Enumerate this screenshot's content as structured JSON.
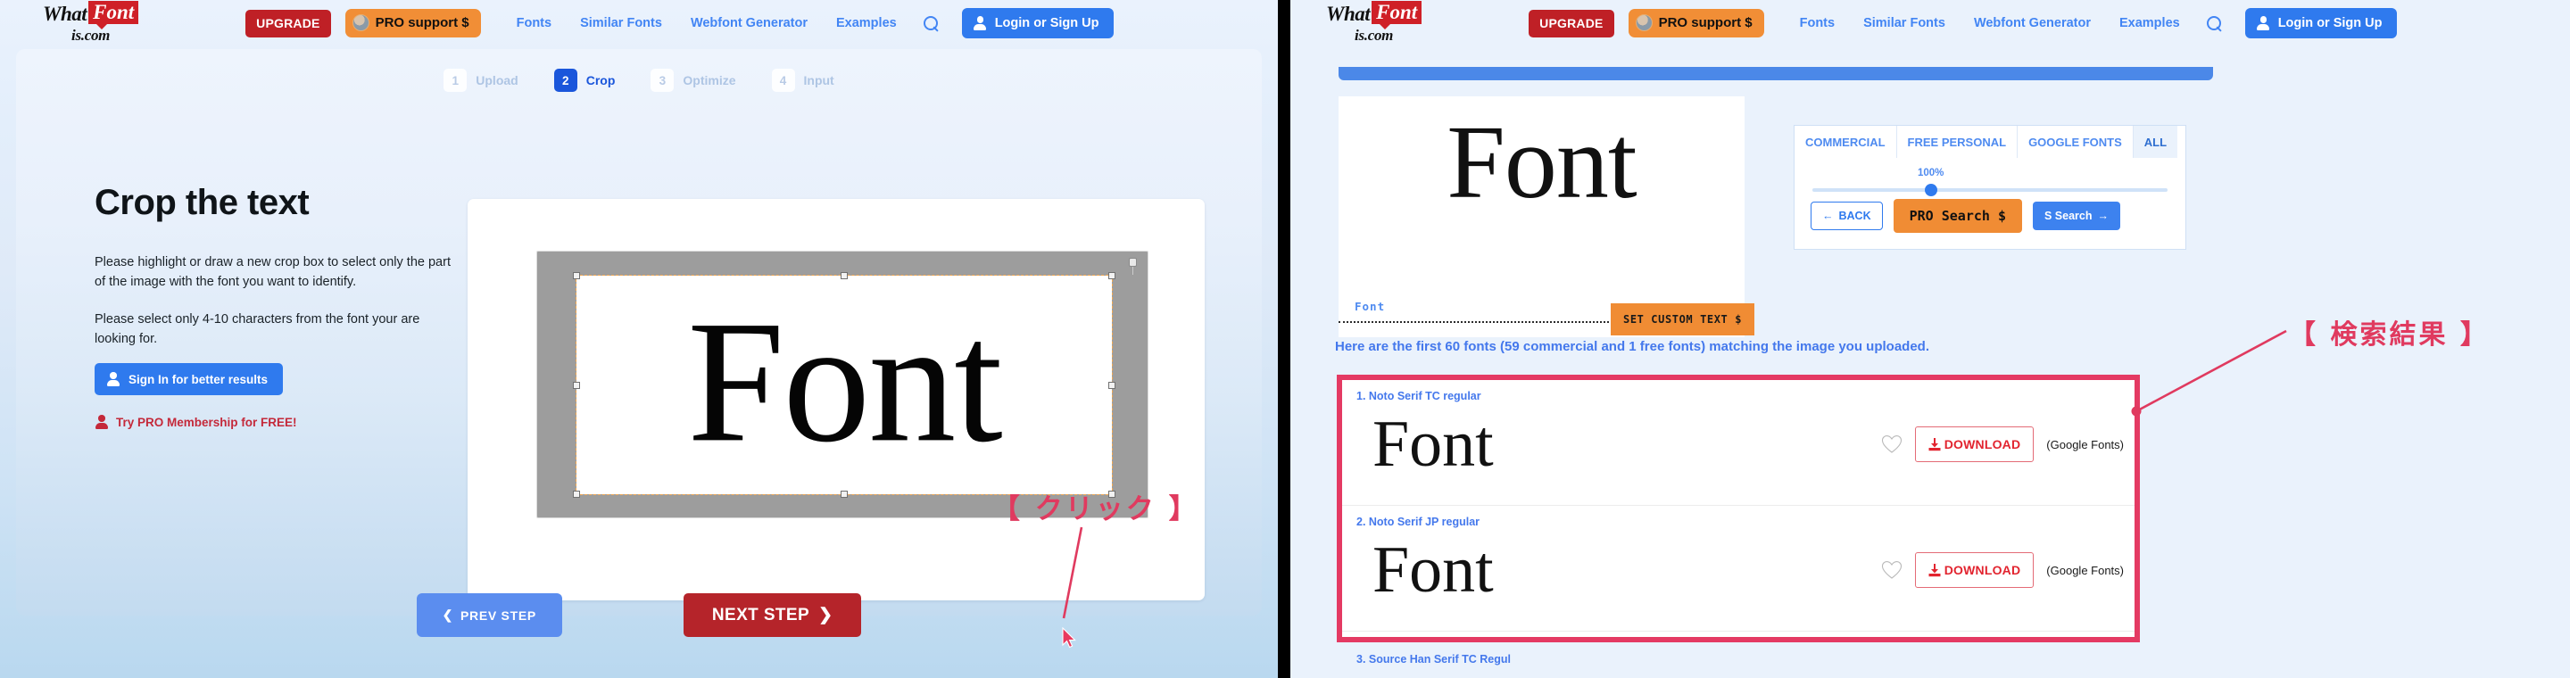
{
  "header": {
    "logo": {
      "word1": "What",
      "word2": "Font",
      "line2": "is.com"
    },
    "upgrade_label": "UPGRADE",
    "pro_support_label": "PRO support $",
    "nav": [
      {
        "label": "Fonts"
      },
      {
        "label": "Similar Fonts"
      },
      {
        "label": "Webfont Generator"
      },
      {
        "label": "Examples"
      }
    ],
    "search_icon": "search-icon",
    "login_label": "Login or Sign Up"
  },
  "left_panel": {
    "steps": [
      {
        "num": "1",
        "label": "Upload",
        "active": false
      },
      {
        "num": "2",
        "label": "Crop",
        "active": true
      },
      {
        "num": "3",
        "label": "Optimize",
        "active": false
      },
      {
        "num": "4",
        "label": "Input",
        "active": false
      }
    ],
    "title": "Crop the text",
    "paragraph1": "Please highlight or draw a new crop box to select only the part of the image with the font you want to identify.",
    "paragraph2": "Please select only 4-10 characters from the font your are looking for.",
    "signin_label": "Sign In for better results",
    "pro_free_label": "Try PRO Membership for FREE!",
    "crop_sample_text": "Font",
    "prev_step_label": "PREV STEP",
    "next_step_label": "NEXT STEP",
    "annotation": "【 クリック 】"
  },
  "right_panel": {
    "preview_text": "Font",
    "preview_label": "Font",
    "set_custom_text_label": "SET CUSTOM TEXT $",
    "filter_tabs": [
      {
        "label": "COMMERCIAL",
        "selected": false
      },
      {
        "label": "FREE PERSONAL",
        "selected": false
      },
      {
        "label": "GOOGLE FONTS",
        "selected": false
      },
      {
        "label": "ALL",
        "selected": true
      }
    ],
    "slider_value": "100%",
    "back_label": "BACK",
    "pro_search_label": "PRO Search $",
    "s_search_label": "S Search",
    "results_headline": "Here are the first 60 fonts (59 commercial and 1 free fonts) matching the image you uploaded.",
    "results": [
      {
        "name": "1. Noto Serif TC regular",
        "sample": "Font",
        "download_label": "DOWNLOAD",
        "source": "(Google Fonts)"
      },
      {
        "name": "2. Noto Serif JP regular",
        "sample": "Font",
        "download_label": "DOWNLOAD",
        "source": "(Google Fonts)"
      }
    ],
    "next_result_name": "3. Source Han Serif TC Regul",
    "annotation": "【 検索結果 】"
  },
  "colors": {
    "brand_blue": "#2f7aee",
    "brand_red": "#bf2026",
    "brand_orange": "#f18e36",
    "annotation_pink": "#e03a5f"
  }
}
